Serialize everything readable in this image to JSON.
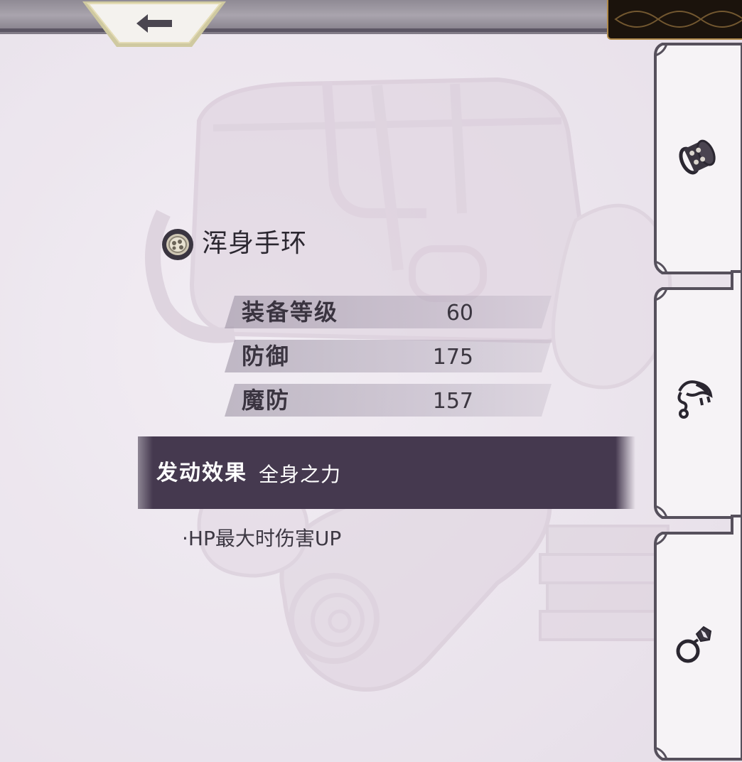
{
  "item": {
    "name": "浑身手环",
    "icon": "bracelet-icon"
  },
  "stats": [
    {
      "label": "装备等级",
      "value": "60"
    },
    {
      "label": "防御",
      "value": "175"
    },
    {
      "label": "魔防",
      "value": "157"
    }
  ],
  "effect": {
    "title": "发动效果",
    "name": "全身之力",
    "description": "·HP最大时伤害UP"
  },
  "tabs": [
    {
      "icon": "bracelet-icon"
    },
    {
      "icon": "necklace-icon"
    },
    {
      "icon": "ring-icon"
    }
  ],
  "back_button": {
    "icon": "back-arrow-icon"
  },
  "colors": {
    "background": "#e9e2ea",
    "banner": "#45394f",
    "text": "#2b2730",
    "gold_trim": "#d9c27a"
  }
}
